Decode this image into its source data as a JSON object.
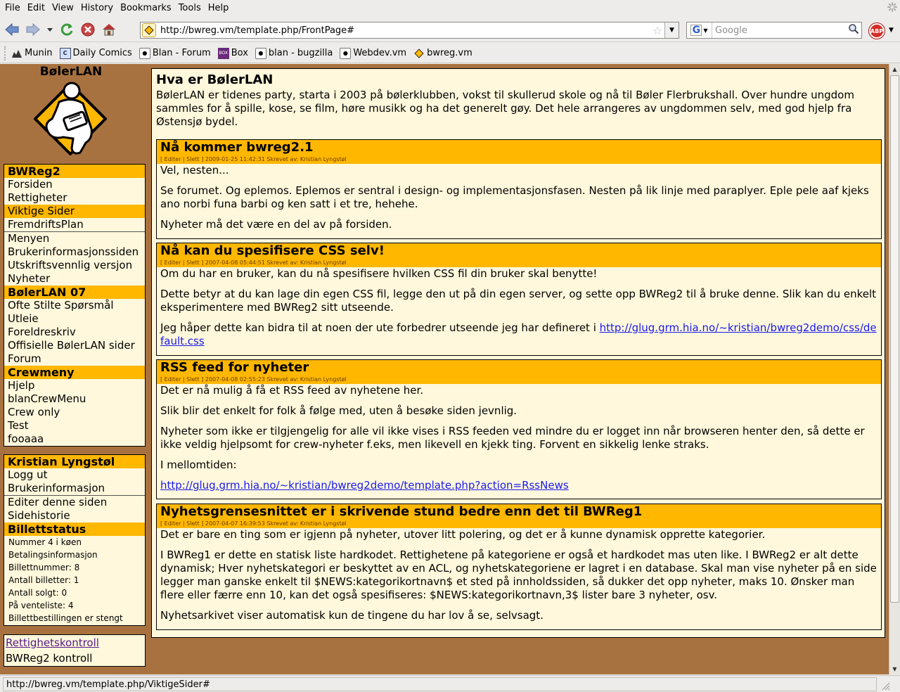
{
  "menubar": {
    "items": [
      "File",
      "Edit",
      "View",
      "History",
      "Bookmarks",
      "Tools",
      "Help"
    ]
  },
  "navbar": {
    "url": "http://bwreg.vm/template.php/FrontPage#",
    "search_placeholder": "Google",
    "abp_label": "ABP"
  },
  "bookmarks": [
    "Munin",
    "Daily Comics",
    "Blan - Forum",
    "Box",
    "blan - bugzilla",
    "Webdev.vm",
    "bwreg.vm"
  ],
  "sidebar": {
    "logo_title": "BølerLAN",
    "box1": {
      "items": [
        {
          "label": "BWReg2",
          "kind": "head"
        },
        {
          "label": "Forsiden",
          "kind": "item"
        },
        {
          "label": "Rettigheter",
          "kind": "item"
        },
        {
          "label": "Viktige Sider",
          "kind": "active"
        },
        {
          "label": "FremdriftsPlan",
          "kind": "item"
        },
        {
          "label": "Menyen",
          "kind": "item"
        },
        {
          "label": "Brukerinformasjonssiden",
          "kind": "item"
        },
        {
          "label": "Utskriftsvennlig versjon",
          "kind": "item"
        },
        {
          "label": "Nyheter",
          "kind": "item"
        },
        {
          "label": "BølerLAN 07",
          "kind": "head"
        },
        {
          "label": "Ofte Stilte Spørsmål",
          "kind": "item"
        },
        {
          "label": "Utleie",
          "kind": "item"
        },
        {
          "label": "Foreldreskriv",
          "kind": "item"
        },
        {
          "label": "Offisielle BølerLAN sider",
          "kind": "item"
        },
        {
          "label": "Forum",
          "kind": "item"
        },
        {
          "label": "Crewmeny",
          "kind": "head"
        },
        {
          "label": "Hjelp",
          "kind": "item"
        },
        {
          "label": "blanCrewMenu",
          "kind": "item"
        },
        {
          "label": "Crew only",
          "kind": "item"
        },
        {
          "label": "Test",
          "kind": "item"
        },
        {
          "label": "fooaaa",
          "kind": "item"
        }
      ]
    },
    "box2": {
      "user": "Kristian Lyngstøl",
      "logout": "Logg ut",
      "userinfo": "Brukerinformasjon",
      "edit_page": "Editer denne siden",
      "history": "Sidehistorie",
      "ticket_head": "Billettstatus",
      "ticket_lines": [
        "Nummer 4 i køen",
        "Betalingsinformasjon",
        "Billettnummer: 8",
        "Antall billetter: 1",
        "Antall solgt: 0",
        "På venteliste: 4",
        "Billettbestillingen er stengt"
      ]
    },
    "box3": {
      "rights_link": "Rettighetskontroll",
      "control": "BWReg2 kontroll"
    }
  },
  "main": {
    "title": "Hva er BølerLAN",
    "intro": "BølerLAN er tidenes party, starta i 2003 på bølerklubben, vokst til skullerud skole og nå til Bøler Flerbrukshall. Over hundre ungdom sammles for å spille, kose, se film, høre musikk og ha det generelt gøy. Det hele arrangeres av ungdommen selv, med god hjelp fra Østensjø bydel.",
    "news": [
      {
        "title": "Nå kommer bwreg2.1",
        "meta": "[ Editer | Slett ] 2009-01-25 11:42:31 Skrevet av: Kristian Lyngstøl",
        "paragraphs": [
          "Vel, nesten...",
          "Se forumet. Og eplemos. Eplemos er sentral i design- og implementasjonsfasen. Nesten på lik linje med paraplyer. Eple pele aaf kjeks ano norbi funa barbi og ken satt i et tre, hehehe.",
          "Nyheter må det være en del av på forsiden."
        ]
      },
      {
        "title": "Nå kan du spesifisere CSS selv!",
        "meta": "[ Editer | Slett ] 2007-04-08 05:44:51 Skrevet av: Kristian Lyngstøl",
        "paragraphs": [
          "Om du har en bruker, kan du nå spesifisere hvilken CSS fil din bruker skal benytte!",
          "Dette betyr at du kan lage din egen CSS fil, legge den ut på din egen server, og sette opp BWReg2 til å bruke denne. Slik kan du enkelt eksperimentere med BWReg2 sitt utseende."
        ],
        "last_text": "Jeg håper dette kan bidra til at noen der ute forbedrer utseende jeg har defineret i ",
        "last_link": "http://glug.grm.hia.no/~kristian/bwreg2demo/css/default.css"
      },
      {
        "title": "RSS feed for nyheter",
        "meta": "[ Editer | Slett ] 2007-04-08 02:55:23 Skrevet av: Kristian Lyngstøl",
        "paragraphs": [
          "Det er nå mulig å få et RSS feed av nyhetene her.",
          "Slik blir det enkelt for folk å følge med, uten å besøke siden jevnlig.",
          "Nyheter som ikke er tilgjengelig for alle vil ikke vises i RSS feeden ved mindre du er logget inn når browseren henter den, så dette er ikke veldig hjelpsomt for crew-nyheter f.eks, men likevell en kjekk ting. Forvent en sikkelig lenke straks.",
          "I mellomtiden:"
        ],
        "link": "http://glug.grm.hia.no/~kristian/bwreg2demo/template.php?action=RssNews"
      },
      {
        "title": "Nyhetsgrensesnittet er i skrivende stund bedre enn det til BWReg1",
        "meta": "[ Editer | Slett ] 2007-04-07 16:39:53 Skrevet av: Kristian Lyngstøl",
        "paragraphs": [
          "Det er bare en ting som er igjenn på nyheter, utover litt polering, og det er å kunne dynamisk opprette kategorier.",
          "I BWReg1 er dette en statisk liste hardkodet. Rettighetene på kategoriene er også et hardkodet mas uten like. I BWReg2 er alt dette dynamisk; Hver nyhetskategori er beskyttet av en ACL, og nyhetskategoriene er lagret i en database. Skal man vise nyheter på en side legger man ganske enkelt til $NEWS:kategorikortnavn$ et sted på innholdssiden, så dukker det opp nyheter, maks 10. Ønsker man flere eller færre enn 10, kan det også spesifiseres: $NEWS:kategorikortnavn,3$ lister bare 3 nyheter, osv.",
          "Nyhetsarkivet viser automatisk kun de tingene du har lov å se, selvsagt."
        ]
      }
    ]
  },
  "statusbar": {
    "text": "http://bwreg.vm/template.php/ViktigeSider#"
  },
  "colors": {
    "page_bg": "#a87240",
    "accent": "#ffb700",
    "panel": "#fff8dc"
  }
}
